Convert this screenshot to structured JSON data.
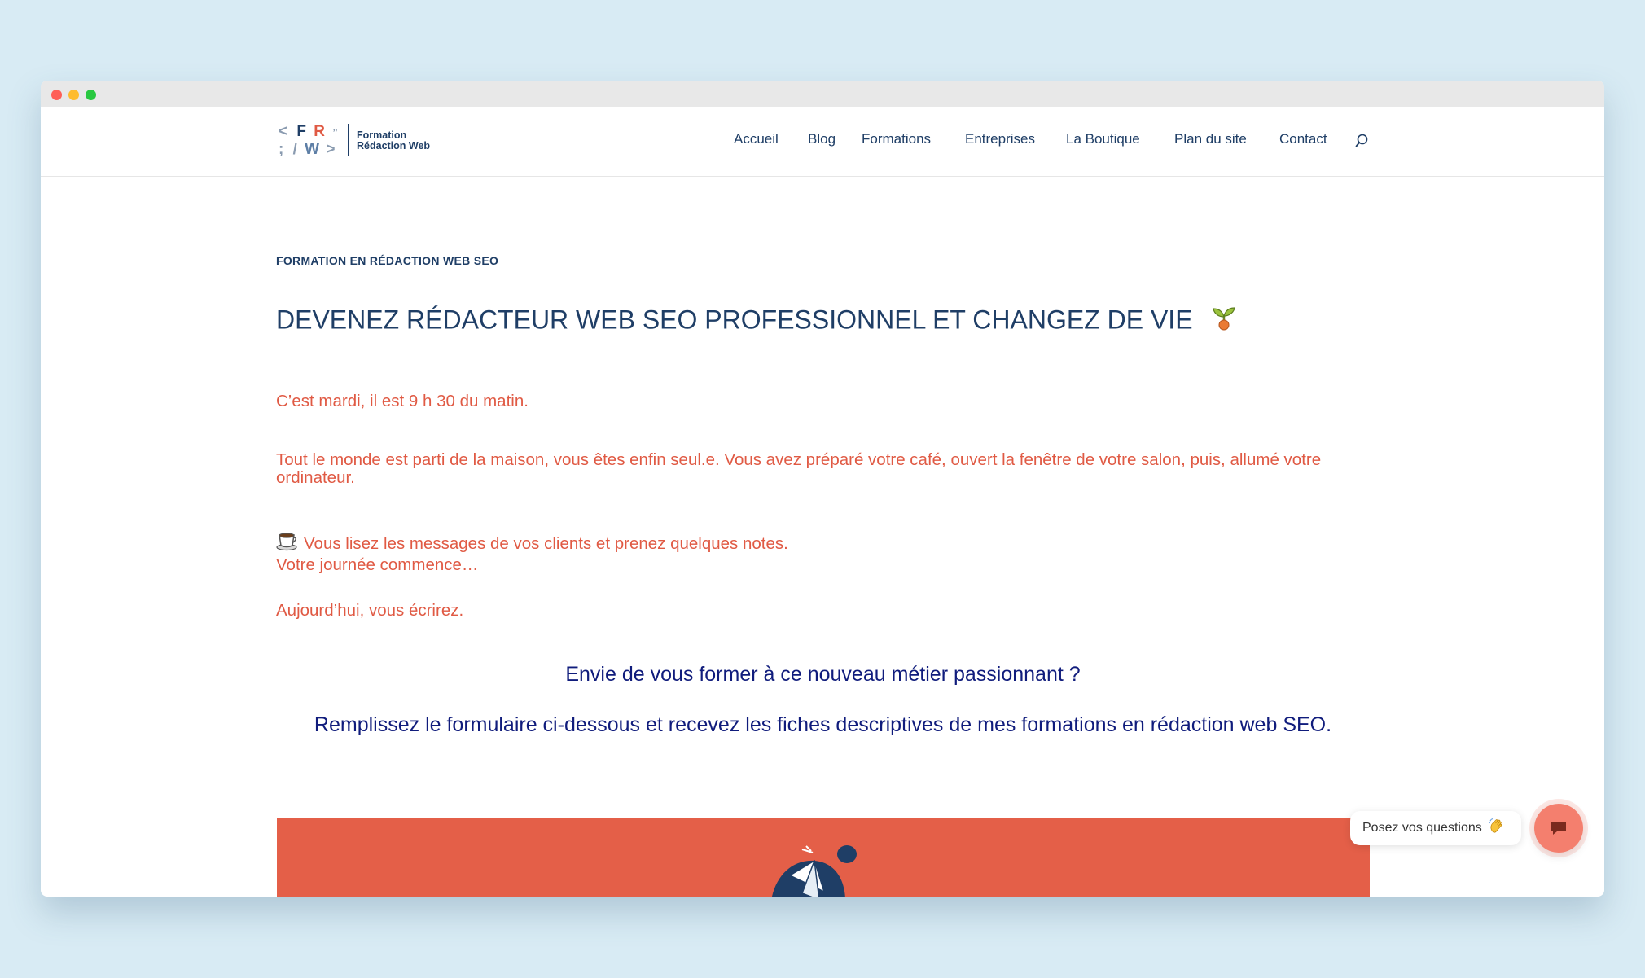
{
  "header": {
    "logo": {
      "mark_row1": [
        "<",
        "F",
        "R",
        "”"
      ],
      "mark_row2": [
        ";",
        "/",
        "W",
        ">"
      ],
      "line1": "Formation",
      "line2": "Rédaction Web"
    },
    "nav": [
      {
        "label": "Accueil"
      },
      {
        "label": "Blog"
      },
      {
        "label": "Formations"
      },
      {
        "label": "Entreprises"
      },
      {
        "label": "La Boutique"
      },
      {
        "label": "Plan du site"
      },
      {
        "label": "Contact"
      }
    ],
    "search_icon": "search-icon"
  },
  "main": {
    "eyebrow": "FORMATION EN RÉDACTION WEB SEO",
    "title": "DEVENEZ RÉDACTEUR WEB SEO PROFESSIONNEL ET CHANGEZ DE VIE",
    "title_icon": "sprout-icon",
    "paragraphs": {
      "p1": "C’est mardi, il est 9 h 30 du matin.",
      "p2": "Tout le monde est parti de la maison, vous êtes enfin seul.e. Vous avez préparé votre café, ouvert la fenêtre de votre salon, puis, allumé votre ordinateur.",
      "p3": "Vous lisez les messages de vos clients et prenez quelques notes.",
      "p4": "Votre journée commence…",
      "p5": "Aujourd’hui, vous écrirez."
    },
    "p3_icon": "coffee-cup-icon",
    "cta": {
      "line1": "Envie de vous former à ce nouveau métier passionnant ?",
      "line2": "Remplissez le formulaire ci-dessous et recevez les fiches descriptives de mes formations en rédaction web SEO."
    }
  },
  "chat": {
    "bubble_text": "Posez vos questions",
    "bubble_icon": "waving-hand-icon",
    "button_icon": "chat-icon"
  },
  "colors": {
    "navy": "#1f3e66",
    "accent": "#e05a44",
    "cta_blue": "#101c7c",
    "banner": "#e45f48",
    "chat": "#f47f6e"
  }
}
